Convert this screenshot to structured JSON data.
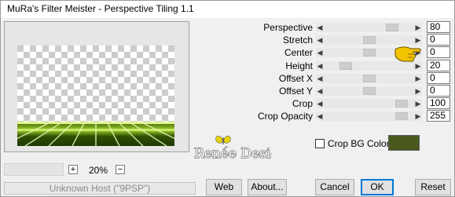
{
  "window": {
    "title": "MuRa's Filter Meister - Perspective Tiling 1.1"
  },
  "controls": [
    {
      "label": "Perspective",
      "value": "80",
      "level": 0.8
    },
    {
      "label": "Stretch",
      "value": "0",
      "level": 0.5
    },
    {
      "label": "Center",
      "value": "0",
      "level": 0.5
    },
    {
      "label": "Height",
      "value": "20",
      "level": 0.2
    },
    {
      "label": "Offset X",
      "value": "0",
      "level": 0.5
    },
    {
      "label": "Offset Y",
      "value": "0",
      "level": 0.5
    },
    {
      "label": "Crop",
      "value": "100",
      "level": 0.92
    },
    {
      "label": "Crop Opacity",
      "value": "255",
      "level": 0.92
    }
  ],
  "crop_bg": {
    "label": "Crop BG Color",
    "checked": false,
    "color": "#4a5a1e"
  },
  "zoom": {
    "minus": "−",
    "plus": "+",
    "label": "20%"
  },
  "status": {
    "text": "Unknown Host (\"9PSP\")"
  },
  "buttons": {
    "web": "Web",
    "about": "About...",
    "cancel": "Cancel",
    "ok": "OK",
    "reset": "Reset"
  },
  "watermark": {
    "text": "Renée Design"
  },
  "colors": {
    "accent": "#0078d7",
    "preview_green": "#7fbf1a",
    "track": "#e8e8e8"
  }
}
